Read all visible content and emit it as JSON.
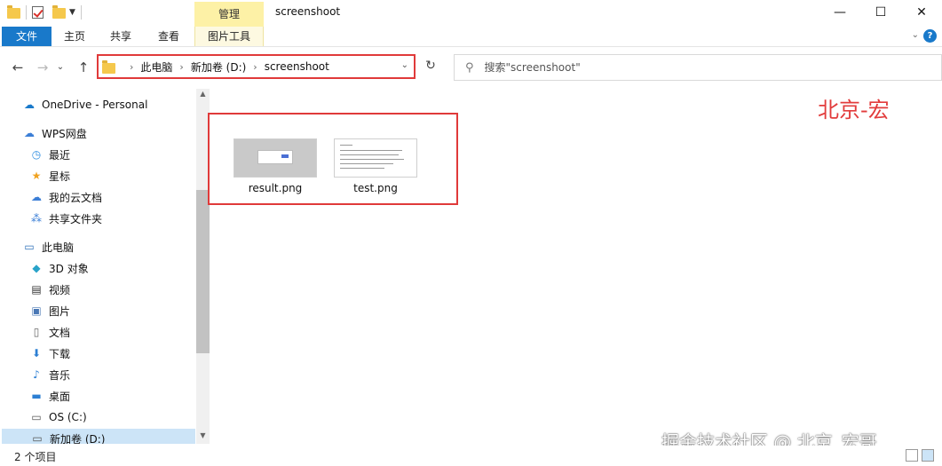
{
  "window": {
    "title": "screenshoot",
    "contextual_tab_group": "管理",
    "minimize": "—",
    "maximize": "☐",
    "close": "✕"
  },
  "ribbon": {
    "tabs": [
      "文件",
      "主页",
      "共享",
      "查看",
      "图片工具"
    ],
    "active_tab": "文件",
    "collapse": "⌄",
    "help": "?"
  },
  "nav": {
    "back": "←",
    "forward": "→",
    "recent": "⌄",
    "up": "↑",
    "breadcrumbs": [
      "此电脑",
      "新加卷 (D:)",
      "screenshoot"
    ],
    "breadcrumb_sep": "›",
    "refresh": "↻",
    "search_placeholder": "搜索\"screenshoot\""
  },
  "sidebar": {
    "items": [
      {
        "label": "OneDrive - Personal",
        "icon": "cloud-icon"
      },
      {
        "label": "WPS网盘",
        "icon": "wps-cloud-icon"
      },
      {
        "label": "最近",
        "icon": "clock-icon"
      },
      {
        "label": "星标",
        "icon": "star-icon"
      },
      {
        "label": "我的云文档",
        "icon": "cloud-doc-icon"
      },
      {
        "label": "共享文件夹",
        "icon": "share-icon"
      },
      {
        "label": "此电脑",
        "icon": "computer-icon"
      },
      {
        "label": "3D 对象",
        "icon": "cube-icon"
      },
      {
        "label": "视频",
        "icon": "video-icon"
      },
      {
        "label": "图片",
        "icon": "picture-icon"
      },
      {
        "label": "文档",
        "icon": "document-icon"
      },
      {
        "label": "下载",
        "icon": "download-icon"
      },
      {
        "label": "音乐",
        "icon": "music-icon"
      },
      {
        "label": "桌面",
        "icon": "desktop-icon"
      },
      {
        "label": "OS (C:)",
        "icon": "drive-icon"
      },
      {
        "label": "新加卷 (D:)",
        "icon": "drive-icon"
      }
    ],
    "selected": "新加卷 (D:)"
  },
  "files": [
    {
      "name": "result.png"
    },
    {
      "name": "test.png"
    }
  ],
  "annotations": {
    "top_label": "北京-宏",
    "bottom_watermark": "掘金技术社区 @ 北京_宏哥"
  },
  "status": {
    "item_count": "2 个项目"
  },
  "colors": {
    "accent": "#1979ca",
    "highlight_box": "#e03a3a",
    "contextual_tab": "#fdf1a6",
    "selected_nav": "#cce4f7"
  }
}
